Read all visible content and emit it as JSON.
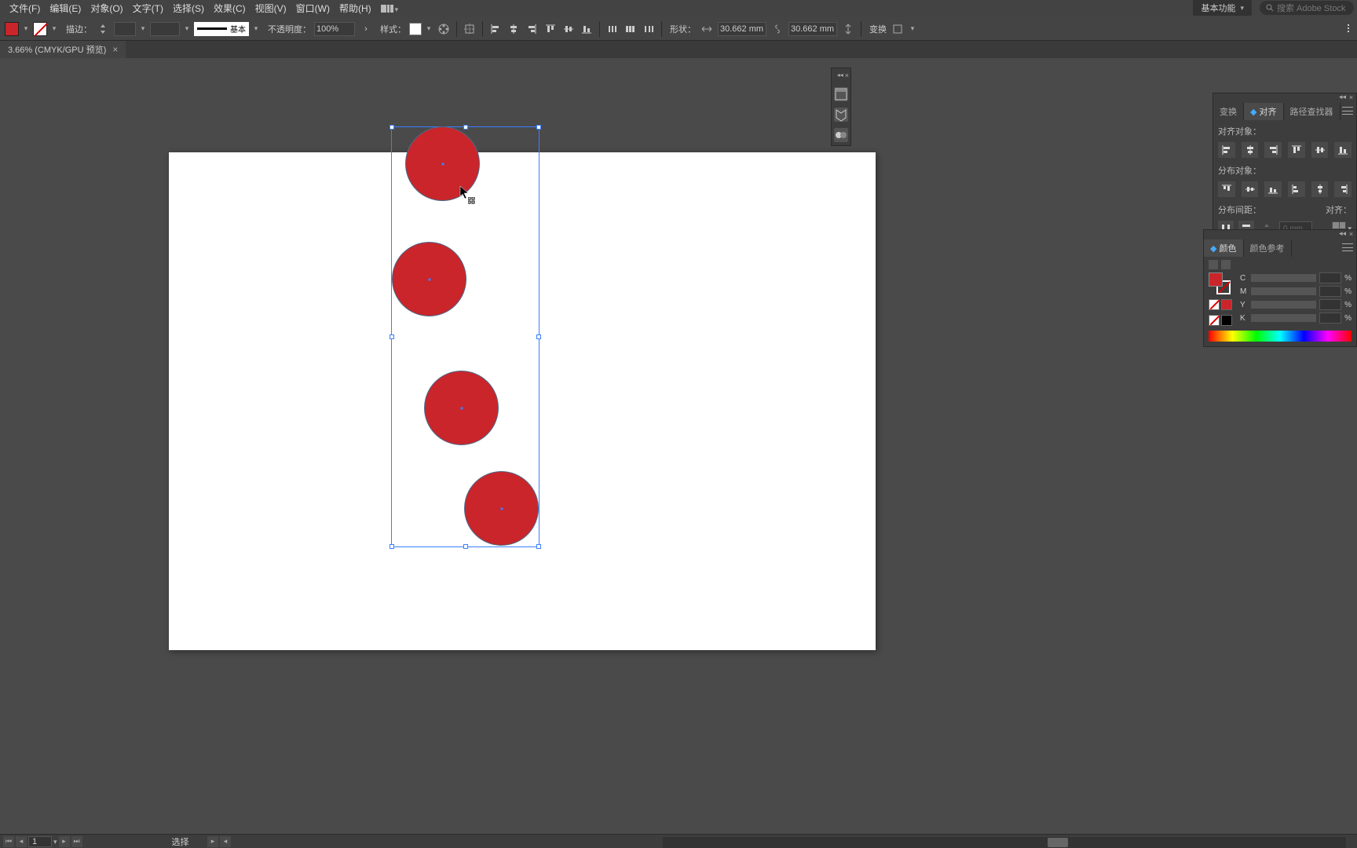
{
  "menubar": {
    "items": [
      "文件(F)",
      "编辑(E)",
      "对象(O)",
      "文字(T)",
      "选择(S)",
      "效果(C)",
      "视图(V)",
      "窗口(W)",
      "帮助(H)"
    ],
    "workspace": "基本功能",
    "search_placeholder": "搜索 Adobe Stock"
  },
  "optbar": {
    "stroke_label": "描边：",
    "stroke_style_text": "基本",
    "opacity_label": "不透明度：",
    "opacity_value": "100%",
    "style_label": "样式：",
    "shape_label": "形状：",
    "width_value": "30.662 mm",
    "height_value": "30.662 mm",
    "transform_label": "变换"
  },
  "doctab": {
    "title": "3.66% (CMYK/GPU 预览)"
  },
  "align_panel": {
    "tab_transform": "变换",
    "tab_align": "对齐",
    "tab_pathfinder": "路径查找器",
    "section_align_objects": "对齐对象：",
    "section_distribute_objects": "分布对象：",
    "section_distribute_spacing": "分布间距：",
    "align_to_label": "对齐：",
    "spacing_value": "0 mm"
  },
  "color_panel": {
    "tab_color": "颜色",
    "tab_color_guide": "颜色参考",
    "channels": [
      "C",
      "M",
      "Y",
      "K"
    ],
    "pct_suffix": "%"
  },
  "statusbar": {
    "page": "1",
    "tool": "选择"
  }
}
